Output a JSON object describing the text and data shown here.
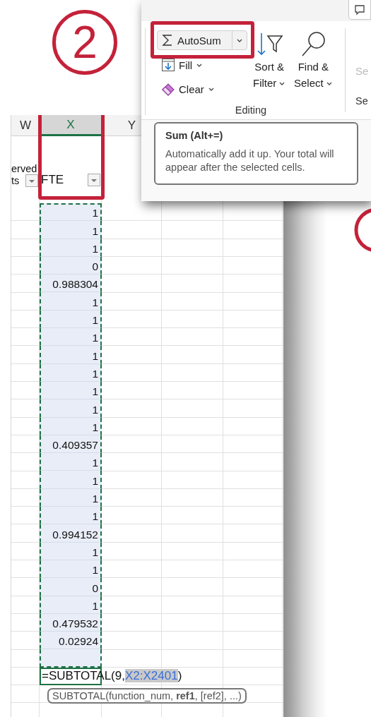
{
  "step_marker": {
    "label": "2"
  },
  "ribbon": {
    "autosum": {
      "label": "AutoSum",
      "highlighted": true
    },
    "fill": {
      "label": "Fill"
    },
    "clear": {
      "label": "Clear"
    },
    "sort_filter": {
      "lines": [
        "Sort &",
        "Filter"
      ]
    },
    "find_select": {
      "lines": [
        "Find &",
        "Select"
      ]
    },
    "group_label": "Editing",
    "next_group_command": {
      "label": "Se",
      "disabled": true
    },
    "next_group_label": "Se"
  },
  "screentip": {
    "title": "Sum (Alt+=)",
    "text": "Automatically add it up. Your total will appear after the selected cells."
  },
  "sheet": {
    "columns": [
      {
        "label": "W",
        "selected": false,
        "highlighted": false
      },
      {
        "label": "X",
        "selected": true,
        "highlighted": true
      },
      {
        "label": "Y",
        "selected": false,
        "highlighted": false
      }
    ],
    "header_cells": [
      {
        "lines": [
          "erved",
          "ts"
        ],
        "filter": true
      },
      {
        "lines": [
          "FTE"
        ],
        "filter": true
      }
    ],
    "x_cells": [
      {
        "value": "1",
        "selected": true
      },
      {
        "value": "1",
        "selected": true
      },
      {
        "value": "1",
        "selected": true
      },
      {
        "value": "0",
        "selected": true
      },
      {
        "value": "0.988304",
        "selected": true
      },
      {
        "value": "1",
        "selected": true
      },
      {
        "value": "1",
        "selected": true
      },
      {
        "value": "1",
        "selected": true
      },
      {
        "value": "1",
        "selected": true
      },
      {
        "value": "1",
        "selected": true
      },
      {
        "value": "1",
        "selected": true
      },
      {
        "value": "1",
        "selected": true
      },
      {
        "value": "1",
        "selected": true
      },
      {
        "value": "0.409357",
        "selected": true
      },
      {
        "value": "1",
        "selected": true
      },
      {
        "value": "1",
        "selected": true
      },
      {
        "value": "1",
        "selected": true
      },
      {
        "value": "1",
        "selected": true
      },
      {
        "value": "0.994152",
        "selected": true
      },
      {
        "value": "1",
        "selected": true
      },
      {
        "value": "1",
        "selected": true
      },
      {
        "value": "0",
        "selected": true
      },
      {
        "value": "1",
        "selected": true
      },
      {
        "value": "0.479532",
        "selected": true
      },
      {
        "value": "0.02924",
        "selected": true
      },
      {
        "selected": true
      }
    ],
    "formula": [
      {
        "text": "=SUBTOTAL(9,",
        "kind": "plain"
      },
      {
        "text": "X2:X2401",
        "kind": "reference"
      },
      {
        "text": ")",
        "kind": "plain"
      }
    ],
    "function_tooltip": "SUBTOTAL(function_num, **ref1**, [ref2], ...)"
  }
}
